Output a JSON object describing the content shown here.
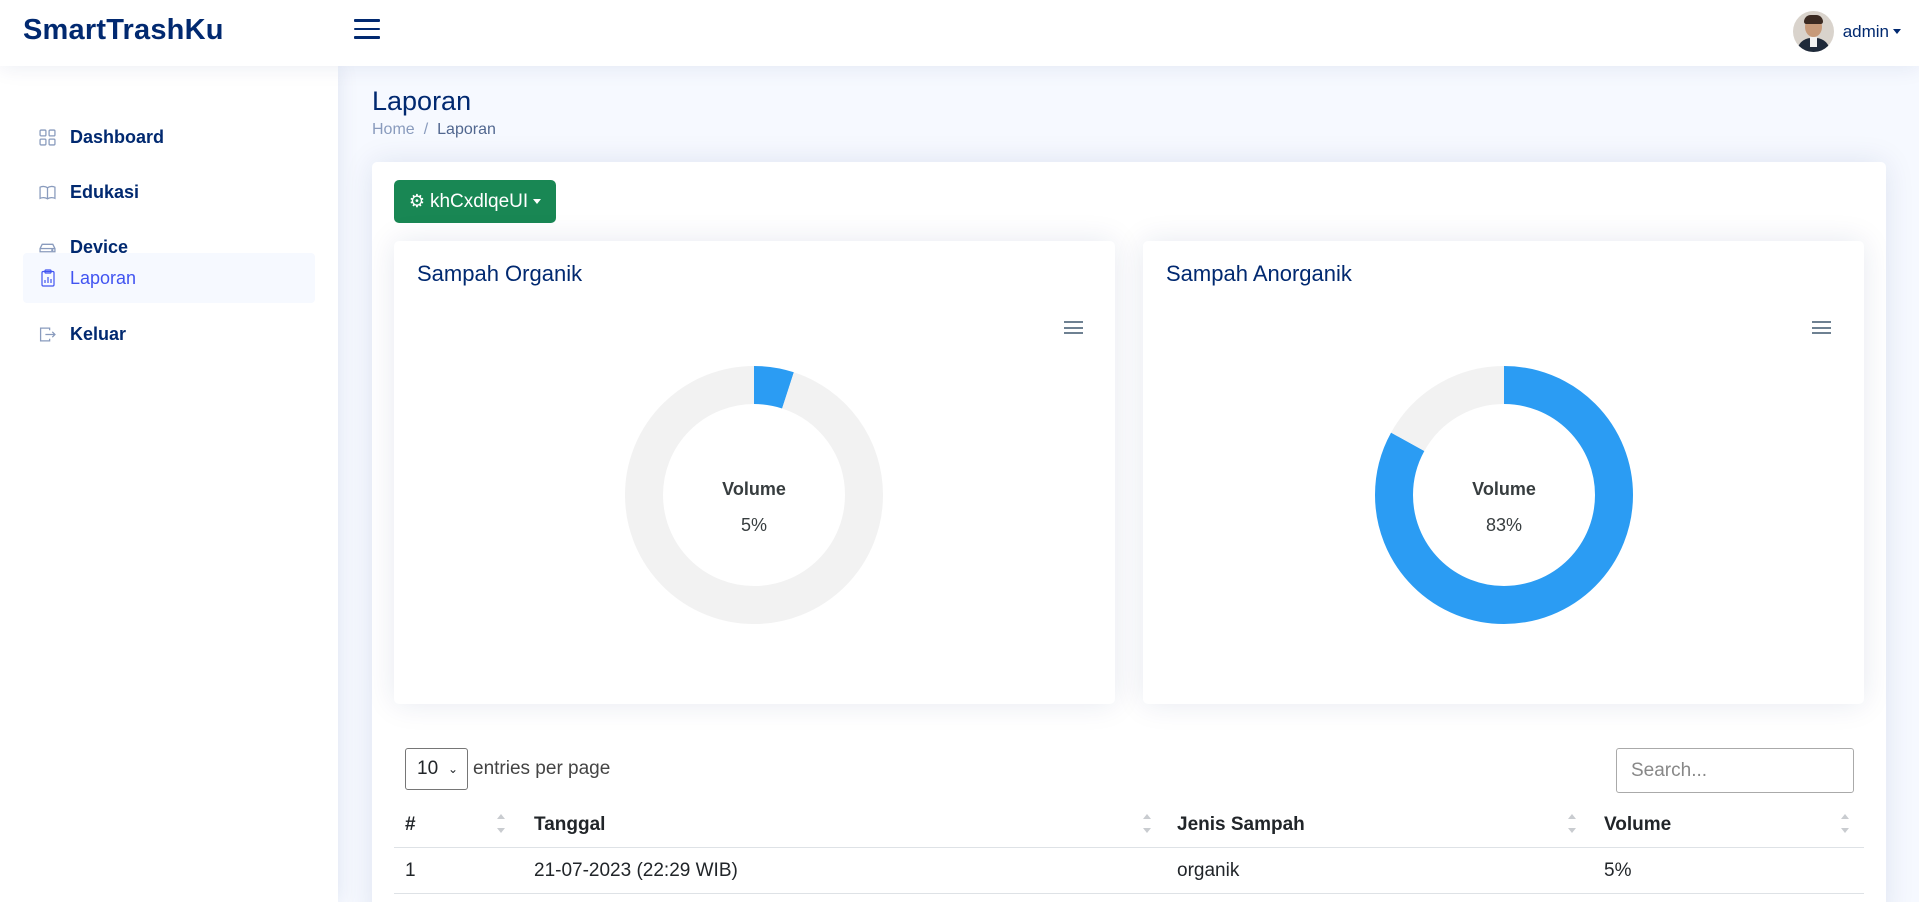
{
  "header": {
    "logo": "SmartTrashKu",
    "user": "admin"
  },
  "sidebar": {
    "items": [
      {
        "label": "Dashboard",
        "icon": "grid-icon"
      },
      {
        "label": "Edukasi",
        "icon": "book-icon"
      },
      {
        "label": "Device",
        "icon": "device-icon"
      },
      {
        "label": "Laporan",
        "icon": "clipboard-chart-icon",
        "active": true
      },
      {
        "label": "Keluar",
        "icon": "logout-icon"
      }
    ]
  },
  "page": {
    "title": "Laporan",
    "breadcrumb": [
      "Home",
      "Laporan"
    ]
  },
  "device_button": {
    "label": "khCxdlqeUI"
  },
  "chart_data": [
    {
      "type": "pie",
      "title": "Sampah Organik",
      "center_label": "Volume",
      "center_value": "5%",
      "values": [
        5,
        95
      ],
      "colors": [
        "#2b9cf3",
        "#f2f2f2"
      ]
    },
    {
      "type": "pie",
      "title": "Sampah Anorganik",
      "center_label": "Volume",
      "center_value": "83%",
      "values": [
        83,
        17
      ],
      "colors": [
        "#2b9cf3",
        "#f2f2f2"
      ]
    }
  ],
  "table": {
    "entries_value": "10",
    "entries_text": "entries per page",
    "search_placeholder": "Search...",
    "columns": [
      "#",
      "Tanggal",
      "Jenis Sampah",
      "Volume"
    ],
    "rows": [
      [
        "1",
        "21-07-2023 (22:29 WIB)",
        "organik",
        "5%"
      ]
    ]
  }
}
